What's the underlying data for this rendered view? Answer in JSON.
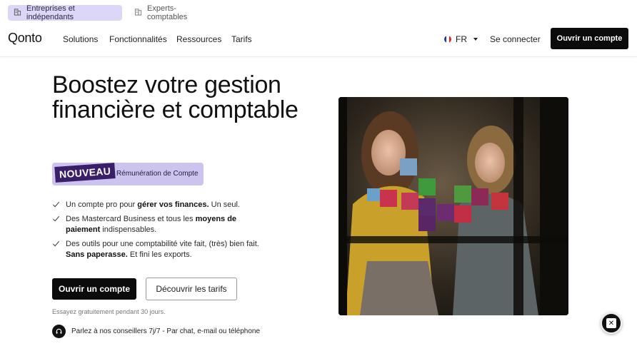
{
  "segments": {
    "active_label": "Entreprises et indépendants",
    "inactive_label": "Experts-comptables"
  },
  "nav": {
    "logo": "Qonto",
    "items": [
      "Solutions",
      "Fonctionnalités",
      "Ressources",
      "Tarifs"
    ],
    "lang": "FR",
    "login": "Se connecter",
    "cta": "Ouvrir un compte"
  },
  "hero": {
    "title": "Boostez votre gestion financière et comptable",
    "badge_new": "NOUVEAU",
    "badge_text": "Rémunération de Compte",
    "bullets": [
      {
        "pre": "Un compte pro pour ",
        "bold": "gérer vos finances.",
        "post": " Un seul."
      },
      {
        "pre": "Des Mastercard Business et tous les ",
        "bold": "moyens de paiement",
        "post": " indispensables."
      },
      {
        "pre": "Des outils pour une comptabilité vite fait, (très) bien fait. ",
        "bold": "Sans paperasse.",
        "post": " Et fini les exports."
      }
    ],
    "primary_button": "Ouvrir un compte",
    "secondary_button": "Découvrir les tarifs",
    "trial": "Essayez gratuitement pendant 30 jours.",
    "advise": "Parlez à nos conseillers 7j/7 - Par chat, e-mail ou téléphone"
  },
  "colors": {
    "accent_purple": "#dcd6f7",
    "badge_bg": "#ccc3ef",
    "badge_dark": "#3a1e68",
    "black": "#0b0b0b"
  },
  "icons": {
    "segment_active": "building-icon",
    "segment_inactive": "office-icon",
    "check": "check-icon",
    "advise": "headset-icon",
    "fab": "close-icon"
  }
}
